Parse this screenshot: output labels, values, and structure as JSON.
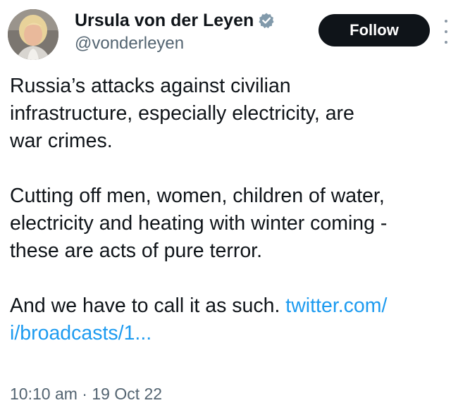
{
  "author": {
    "display_name": "Ursula von der Leyen",
    "handle": "@vonderleyen",
    "verified_icon": "verified-badge-icon",
    "avatar_icon": "avatar"
  },
  "actions": {
    "follow_label": "Follow",
    "more_icon": "more-vertical-icon"
  },
  "tweet": {
    "paragraphs": [
      {
        "lines": [
          "Russia’s attacks against civilian",
          "infrastructure, especially electricity, are",
          "war crimes."
        ]
      },
      {
        "lines": [
          "Cutting off men, women, children of water,",
          "electricity and heating with winter coming -",
          "these are acts of pure terror."
        ]
      },
      {
        "line1_text": "And we have to call it as such. ",
        "line1_link": "twitter.com/",
        "line2_link": "i/broadcasts/1..."
      }
    ]
  },
  "meta": {
    "time": "10:10 am",
    "separator": "·",
    "date": "19 Oct 22"
  },
  "colors": {
    "text": "#0f1419",
    "secondary": "#536471",
    "link": "#1d9bf0",
    "follow_bg": "#0f1419",
    "verified": "#829aab"
  }
}
